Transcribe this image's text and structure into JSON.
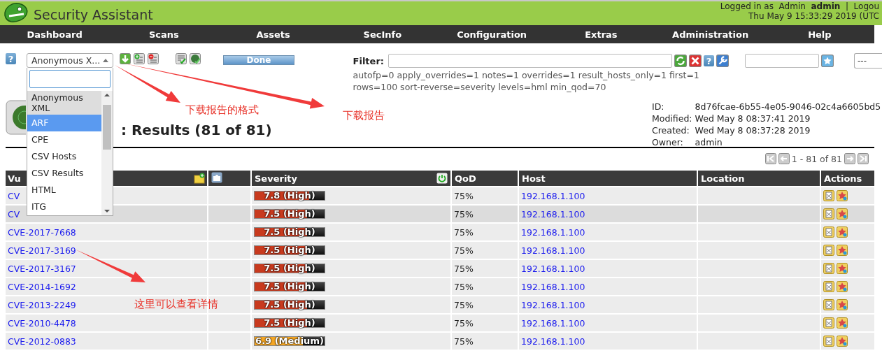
{
  "header": {
    "logo_bottom": "Security Assistant",
    "login_line": "Logged in as  Admin  **admin**  |  Logou",
    "datetime": "Thu May 9 15:33:29 2019 (UTC"
  },
  "nav": [
    "Dashboard",
    "Scans",
    "Assets",
    "SecInfo",
    "Configuration",
    "Extras",
    "Administration",
    "Help"
  ],
  "toolbar": {
    "help_glyph": "?",
    "done_button": "Done"
  },
  "format_dropdown": {
    "value": "Anonymous X...",
    "options": [
      {
        "label": "Anonymous XML",
        "current": true,
        "selected": false
      },
      {
        "label": "ARF",
        "current": false,
        "selected": true
      },
      {
        "label": "CPE",
        "current": false,
        "selected": false
      },
      {
        "label": "CSV Hosts",
        "current": false,
        "selected": false
      },
      {
        "label": "CSV Results",
        "current": false,
        "selected": false
      },
      {
        "label": "HTML",
        "current": false,
        "selected": false
      },
      {
        "label": "ITG",
        "current": false,
        "selected": false
      }
    ]
  },
  "filter": {
    "label": "Filter:",
    "help_glyph": "?",
    "lines": [
      "autofp=0 apply_overrides=1 notes=1 overrides=1 result_hosts_only=1 first=1",
      "rows=100 sort-reverse=severity levels=hml min_qod=70"
    ],
    "select_value": "---"
  },
  "report": {
    "title": ": Results (81 of 81)",
    "details": [
      {
        "label": "ID:",
        "value": "8d76fcae-6b55-4e05-9046-02c4a6605bd5"
      },
      {
        "label": "Modified:",
        "value": "Wed May 8 08:37:41 2019"
      },
      {
        "label": "Created:",
        "value": "Wed May 8 08:37:28 2019"
      },
      {
        "label": "Owner:",
        "value": "admin"
      }
    ]
  },
  "pagination": "1 - 81 of 81",
  "results": {
    "columns": {
      "column_1": "Vu",
      "severity": "Severity",
      "qod": "QoD",
      "host": "Host",
      "location": "Location",
      "actions": "Actions"
    },
    "rows": [
      {
        "vulnerability": "CV",
        "severity": "7.8 (High)",
        "level": 0.78,
        "color": "#c83a1e",
        "qod": "75%",
        "host": "192.168.1.100",
        "highlighted": false
      },
      {
        "vulnerability": "CV",
        "severity": "7.5 (High)",
        "level": 0.75,
        "color": "#c83a1e",
        "qod": "75%",
        "host": "192.168.1.100",
        "highlighted": true
      },
      {
        "vulnerability": "CVE-2017-7668",
        "severity": "7.5 (High)",
        "level": 0.75,
        "color": "#c83a1e",
        "qod": "75%",
        "host": "192.168.1.100",
        "highlighted": false
      },
      {
        "vulnerability": "CVE-2017-3169",
        "severity": "7.5 (High)",
        "level": 0.75,
        "color": "#c83a1e",
        "qod": "75%",
        "host": "192.168.1.100",
        "highlighted": false
      },
      {
        "vulnerability": "CVE-2017-3167",
        "severity": "7.5 (High)",
        "level": 0.75,
        "color": "#c83a1e",
        "qod": "75%",
        "host": "192.168.1.100",
        "highlighted": false
      },
      {
        "vulnerability": "CVE-2014-1692",
        "severity": "7.5 (High)",
        "level": 0.75,
        "color": "#c83a1e",
        "qod": "75%",
        "host": "192.168.1.100",
        "highlighted": false
      },
      {
        "vulnerability": "CVE-2013-2249",
        "severity": "7.5 (High)",
        "level": 0.75,
        "color": "#c83a1e",
        "qod": "75%",
        "host": "192.168.1.100",
        "highlighted": false
      },
      {
        "vulnerability": "CVE-2010-4478",
        "severity": "7.5 (High)",
        "level": 0.75,
        "color": "#c83a1e",
        "qod": "75%",
        "host": "192.168.1.100",
        "highlighted": false
      },
      {
        "vulnerability": "CVE-2012-0883",
        "severity": "6.9 (Medium)",
        "level": 0.69,
        "color": "#f5a623",
        "qod": "75%",
        "host": "192.168.1.100",
        "highlighted": false
      }
    ]
  },
  "annotations": [
    {
      "text": "下载报告的格式"
    },
    {
      "text": "下载报告"
    },
    {
      "text": "这里可以查看详情"
    }
  ]
}
